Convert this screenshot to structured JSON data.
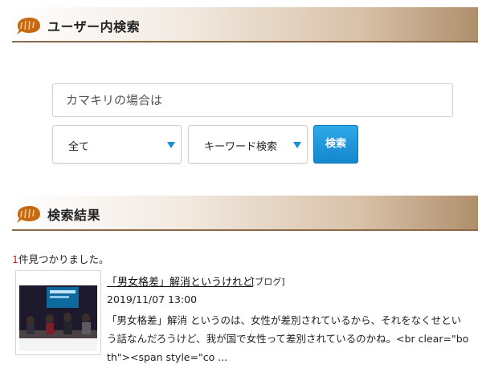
{
  "user_search": {
    "header_title": "ユーザー内検索",
    "header_icon": "speech-bubble-icon",
    "search_placeholder": "カマキリの場合は",
    "scope_select": {
      "selected": "全て",
      "icon": "caret-down-icon"
    },
    "mode_select": {
      "selected": "キーワード検索",
      "icon": "caret-down-icon"
    },
    "search_button_label": "検索",
    "accent_color": "#1a8fcf"
  },
  "results": {
    "header_title": "検索結果",
    "count": "1",
    "count_suffix": "件見つかりました。",
    "count_color": "#d3201f",
    "items": [
      {
        "title": "「男女格差」解消というけれど",
        "tag": "[ブログ]",
        "date": "2019/11/07 13:00",
        "excerpt": "「男女格差」解消 というのは、女性が差別されているから、それをなくせという話なんだろうけど、我が国で女性って差別されているのかね。<br clear=\"both\"><span style=\"co ..."
      }
    ]
  }
}
